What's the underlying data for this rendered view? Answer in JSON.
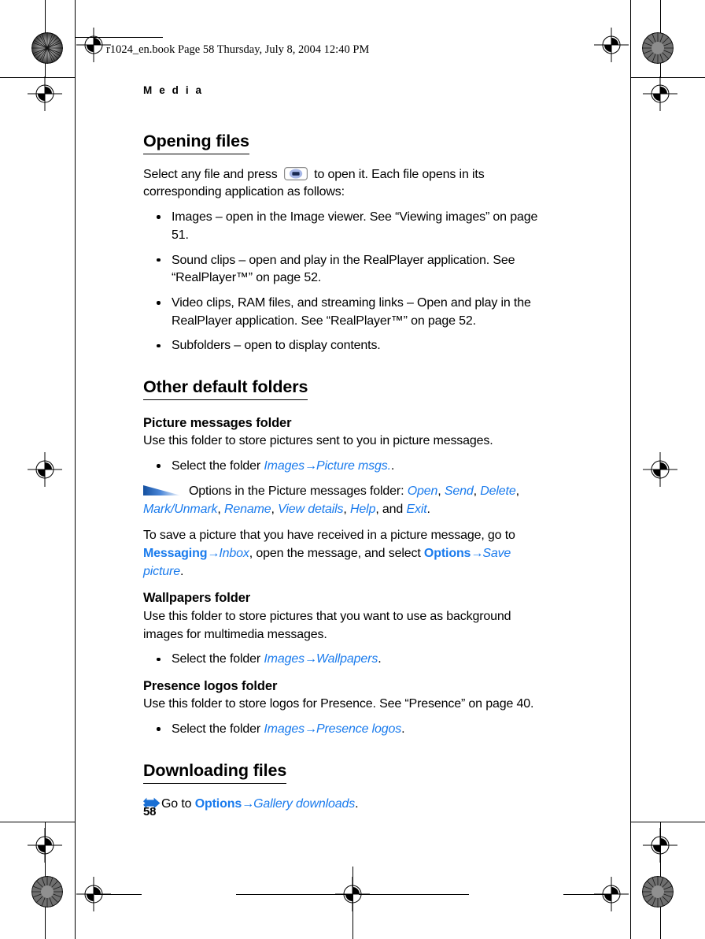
{
  "print_header": {
    "text": "r1024_en.book  Page 58  Thursday, July 8, 2004  12:40 PM"
  },
  "running_head": "M e d i a",
  "page_number": "58",
  "colors": {
    "link_blue": "#1a7bed",
    "wedge_blue": "#1b62c4",
    "key_oval": "#a8b8e8",
    "key_bar": "#1a2a52"
  },
  "sections": [
    {
      "id": "opening-files",
      "heading": "Opening files",
      "intro_before_key": "Select any file and press",
      "intro_after_key": "to open it. Each file opens in its corresponding application as follows:",
      "bullets": [
        "Images – open in the Image viewer. See “Viewing images” on page 51.",
        "Sound clips – open and play in the RealPlayer application. See “RealPlayer™” on page 52.",
        "Video clips, RAM files, and streaming links – Open and play in the RealPlayer application. See “RealPlayer™” on page 52.",
        "Subfolders – open to display contents."
      ]
    },
    {
      "id": "other-default-folders",
      "heading": "Other default folders",
      "subsections": [
        {
          "id": "picture-messages-folder",
          "title": "Picture messages folder",
          "body": "Use this folder to store pictures sent to you in picture messages.",
          "bullet_prefix": "Select the folder",
          "path": [
            "Images",
            "Picture msgs."
          ],
          "bullet_suffix": ".",
          "note": {
            "lead": "Options in the Picture messages folder:",
            "items": [
              "Open",
              "Send",
              "Delete",
              "Mark/Unmark",
              "Rename",
              "View details",
              "Help",
              "Exit"
            ],
            "conjunction": "and",
            "terminator": "."
          },
          "trailing_paragraph": {
            "part1": "To save a picture that you have received in a picture message, go to",
            "path1": [
              "Messaging",
              "Inbox"
            ],
            "part2": ", open the message, and select",
            "path2": [
              "Options",
              "Save picture"
            ],
            "part3": "."
          }
        },
        {
          "id": "wallpapers-folder",
          "title": "Wallpapers folder",
          "body": "Use this folder to store pictures that you want to use as background images for multimedia messages.",
          "bullet_prefix": "Select the folder",
          "path": [
            "Images",
            "Wallpapers"
          ],
          "bullet_suffix": "."
        },
        {
          "id": "presence-logos-folder",
          "title": "Presence logos folder",
          "body": "Use this folder to store logos for Presence. See “Presence” on page 40.",
          "bullet_prefix": "Select the folder",
          "path": [
            "Images",
            "Presence logos"
          ],
          "bullet_suffix": "."
        }
      ]
    },
    {
      "id": "downloading-files",
      "heading": "Downloading files",
      "goto_prefix": "Go to",
      "goto_path": [
        "Options",
        "Gallery downloads"
      ],
      "goto_suffix": "."
    }
  ],
  "icons": {
    "select_key": "select-key-icon",
    "note_wedge": "note-wedge-icon",
    "goto_arrow": "goto-arrow-icon",
    "registration": "registration-mark-icon",
    "rosette": "color-rosette-icon"
  }
}
